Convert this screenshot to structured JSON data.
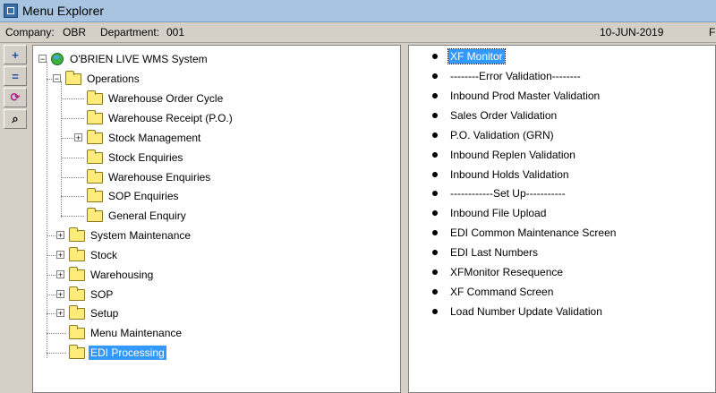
{
  "window": {
    "title": "Menu Explorer"
  },
  "info": {
    "company_label": "Company:",
    "company_value": "OBR",
    "department_label": "Department:",
    "department_value": "001",
    "date": "10-JUN-2019",
    "cut_text": "F"
  },
  "toolbar": {
    "buttons": [
      {
        "name": "expand-all-icon",
        "glyph": "+"
      },
      {
        "name": "collapse-all-icon",
        "glyph": "="
      },
      {
        "name": "refresh-icon",
        "glyph": "⟳"
      },
      {
        "name": "search-icon",
        "glyph": "⌕"
      }
    ]
  },
  "tree": {
    "root": "O'BRIEN LIVE WMS System",
    "operations": "Operations",
    "ops_children": [
      "Warehouse Order Cycle",
      "Warehouse Receipt (P.O.)",
      "Stock Management",
      "Stock Enquiries",
      "Warehouse Enquiries",
      "SOP Enquiries",
      "General Enquiry"
    ],
    "top_level": [
      "System Maintenance",
      "Stock",
      "Warehousing",
      "SOP",
      "Setup",
      "Menu Maintenance",
      "EDI Processing"
    ]
  },
  "menu_items": [
    "XF Monitor",
    "--------Error Validation--------",
    "Inbound Prod Master Validation",
    "Sales Order Validation",
    "P.O. Validation (GRN)",
    "Inbound Replen Validation",
    "Inbound Holds Validation",
    "------------Set Up-----------",
    "Inbound File Upload",
    "EDI Common Maintenance Screen",
    "EDI Last Numbers",
    "XFMonitor Resequence",
    "XF Command Screen",
    "Load Number Update Validation"
  ],
  "colors": {
    "selection": "#3399ff",
    "titlebar": "#a8c4e0",
    "folder": "#ffeb7a"
  }
}
